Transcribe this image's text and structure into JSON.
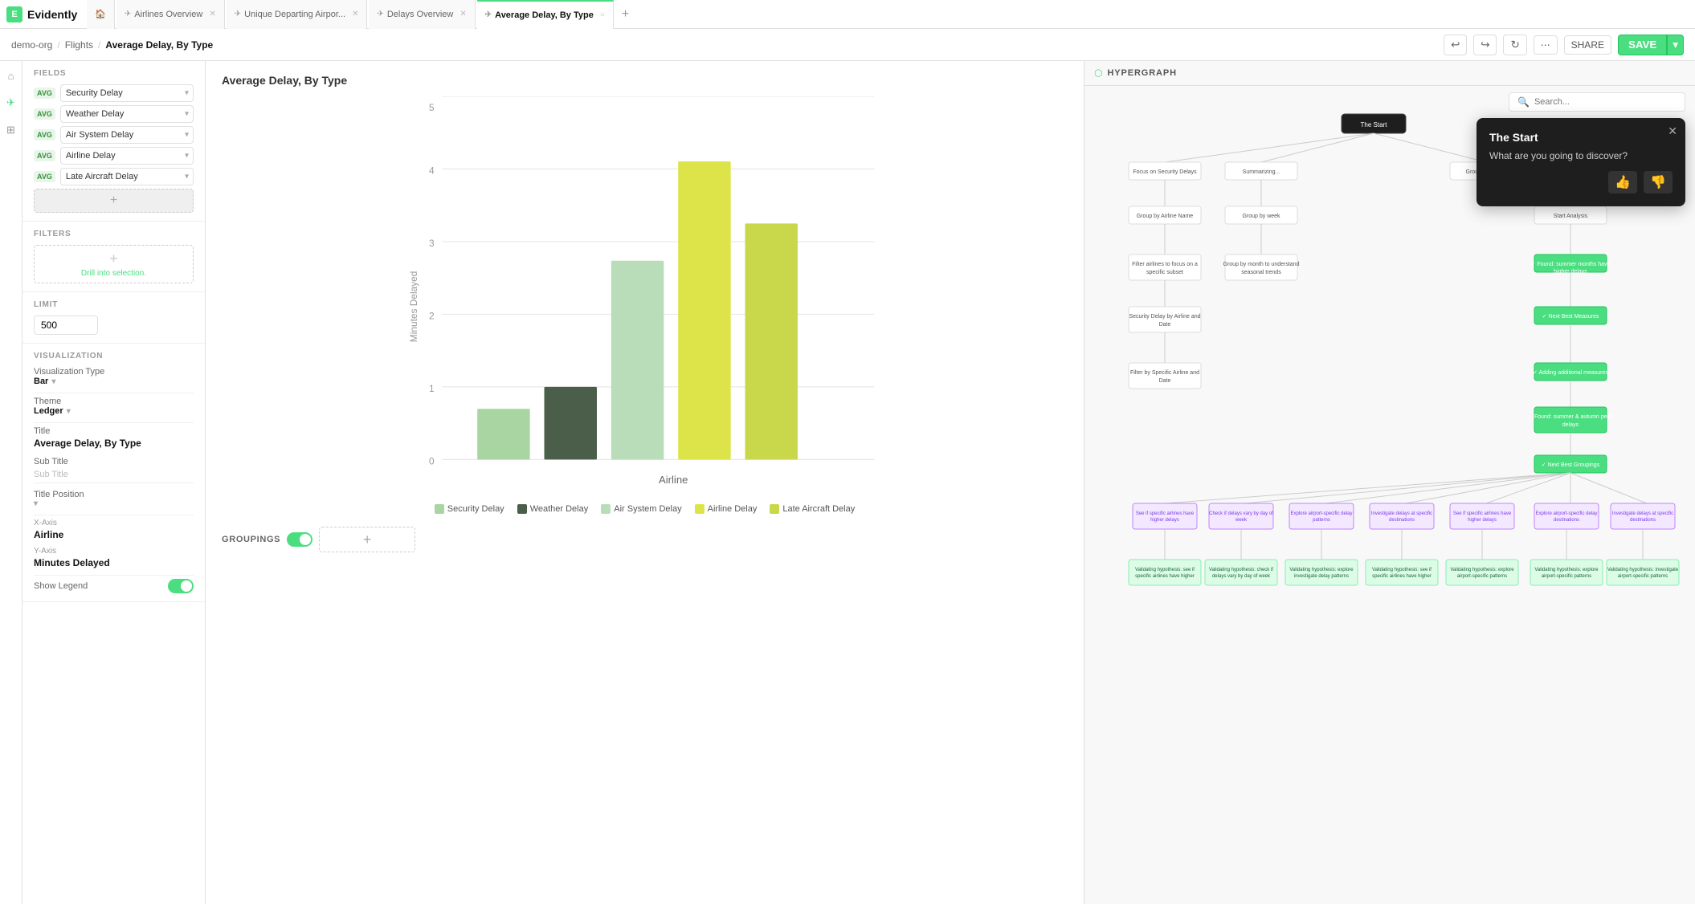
{
  "app": {
    "name": "Evidently",
    "logo_letter": "E"
  },
  "tabs": [
    {
      "id": "home",
      "label": "",
      "icon": "🏠",
      "active": false,
      "closeable": false
    },
    {
      "id": "airlines-overview",
      "label": "Airlines Overview",
      "icon": "✈",
      "active": false,
      "closeable": true
    },
    {
      "id": "unique-departing",
      "label": "Unique Departing Airpor...",
      "icon": "✈",
      "active": false,
      "closeable": true
    },
    {
      "id": "delays-overview",
      "label": "Delays Overview",
      "icon": "✈",
      "active": false,
      "closeable": true
    },
    {
      "id": "average-delay",
      "label": "Average Delay, By Type",
      "icon": "✈",
      "active": true,
      "closeable": true
    }
  ],
  "breadcrumb": {
    "items": [
      "demo-org",
      "Flights",
      "Average Delay, By Type"
    ]
  },
  "toolbar": {
    "undo_label": "↩",
    "redo_label": "↪",
    "refresh_label": "↻",
    "more_label": "⋯",
    "share_label": "SHARE",
    "save_label": "SAVE",
    "save_arrow": "▾"
  },
  "fields_section": {
    "title": "FIELDS",
    "items": [
      {
        "badge": "AVG",
        "name": "Security Delay"
      },
      {
        "badge": "AVG",
        "name": "Weather Delay"
      },
      {
        "badge": "AVG",
        "name": "Air System Delay"
      },
      {
        "badge": "AVG",
        "name": "Airline Delay"
      },
      {
        "badge": "AVG",
        "name": "Late Aircraft Delay"
      }
    ],
    "add_label": "+"
  },
  "filters_section": {
    "title": "FILTERS",
    "drill_text": "Drill into selection.",
    "add_label": "+"
  },
  "limit_section": {
    "title": "LIMIT",
    "value": "500"
  },
  "visualization_section": {
    "title": "VISUALIZATION",
    "type_label": "Visualization Type",
    "type_value": "Bar",
    "theme_label": "Theme",
    "theme_value": "Ledger",
    "chart_title_label": "Title",
    "chart_title_value": "Average Delay, By Type",
    "subtitle_label": "Sub Title",
    "subtitle_placeholder": "Sub Title",
    "title_position_label": "Title Position",
    "x_axis_label": "X-Axis",
    "x_axis_value": "Airline",
    "y_axis_label": "Y-Axis",
    "y_axis_value": "Minutes Delayed",
    "show_legend_label": "Show Legend"
  },
  "chart": {
    "title": "Average Delay, By Type",
    "x_axis_label": "Airline",
    "y_axis_label": "Minutes Delayed",
    "y_ticks": [
      "0",
      "1",
      "2",
      "3",
      "4",
      "5"
    ],
    "bars": [
      {
        "label": "Security Delay",
        "color": "#a8d5a2",
        "height_pct": 14
      },
      {
        "label": "Weather Delay",
        "color": "#4a5e4a",
        "height_pct": 20
      },
      {
        "label": "Air System Delay",
        "color": "#c8e6c9",
        "height_pct": 55
      },
      {
        "label": "Airline Delay",
        "color": "#e8f5a0",
        "height_pct": 82
      },
      {
        "label": "Late Aircraft Delay",
        "color": "#d4ed8a",
        "height_pct": 65
      }
    ],
    "legend": [
      {
        "label": "Security Delay",
        "color": "#a8d5a2"
      },
      {
        "label": "Weather Delay",
        "color": "#4a5e4a"
      },
      {
        "label": "Air System Delay",
        "color": "#c8e6c9"
      },
      {
        "label": "Airline Delay",
        "color": "#dde44a"
      },
      {
        "label": "Late Aircraft Delay",
        "color": "#c8d84a"
      }
    ]
  },
  "groupings": {
    "label": "GROUPINGS",
    "enabled": true,
    "add_label": "+"
  },
  "hypergraph": {
    "title": "HYPERGRAPH",
    "search_placeholder": "Search...",
    "tooltip": {
      "title": "The Start",
      "body": "What are you going to discover?",
      "thumbup": "👍",
      "thumbdown": "👎"
    }
  }
}
